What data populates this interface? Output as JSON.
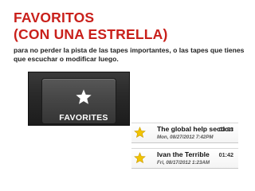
{
  "slide": {
    "title_line1": "FAVORITOS",
    "title_line2": "(CON UNA ESTRELLA)",
    "body": "para no perder la pista de las tapes importantes, o las tapes que tienes que escuchar o modificar luego."
  },
  "favorites_tab": {
    "label": "FAVORITES",
    "icon": "star-icon"
  },
  "favorite_list": [
    {
      "title": "The global help section",
      "timestamp": "Mon, 08/27/2012 7:42PM",
      "duration": "03:03",
      "icon": "star-icon"
    },
    {
      "title": "Ivan the Terrible",
      "timestamp": "Fri, 08/17/2012 1:23AM",
      "duration": "01:42",
      "icon": "star-icon"
    }
  ],
  "colors": {
    "title": "#c9201b",
    "star_yellow": "#f2c400",
    "tab_background": "#2a2a2a"
  }
}
